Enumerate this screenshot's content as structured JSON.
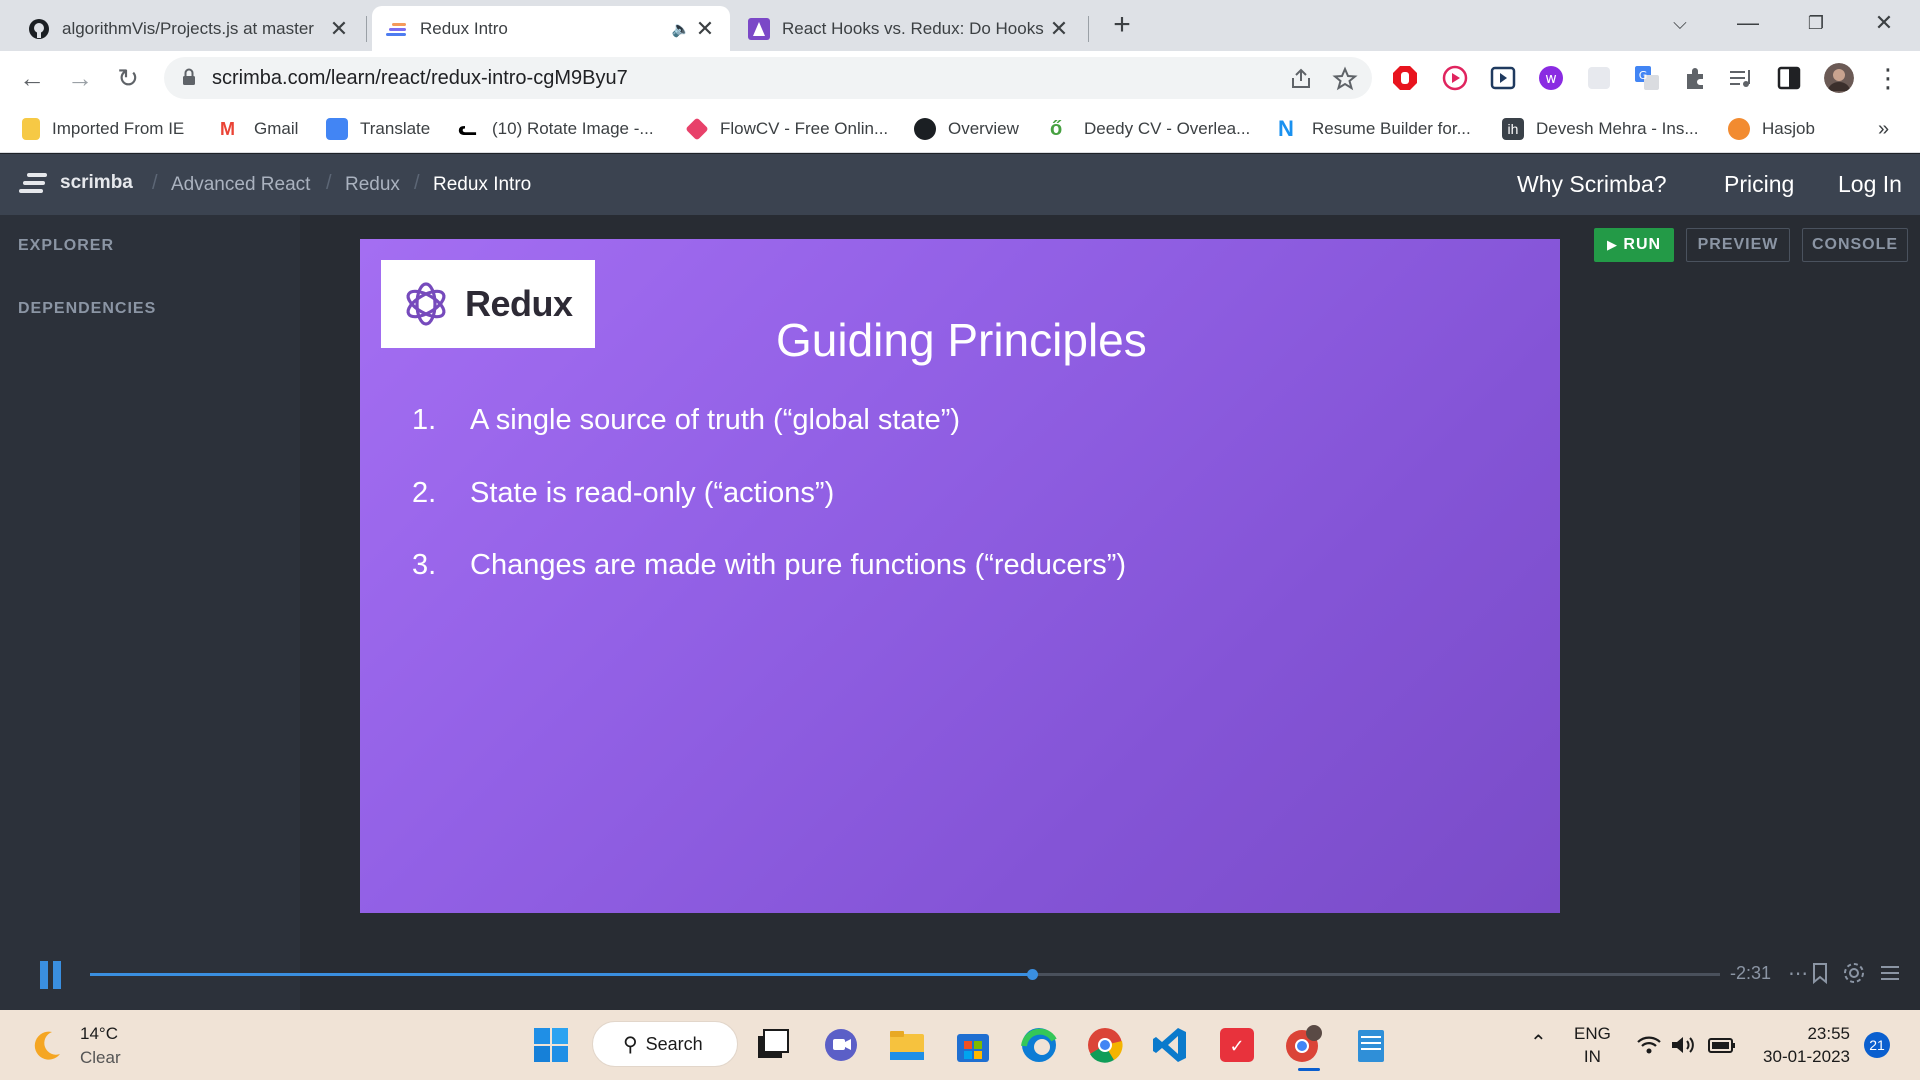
{
  "browser": {
    "tabs": [
      {
        "title": "algorithmVis/Projects.js at master"
      },
      {
        "title": "Redux Intro"
      },
      {
        "title": "React Hooks vs. Redux: Do Hooks"
      }
    ],
    "url": "scrimba.com/learn/react/redux-intro-cgM9Byu7",
    "bookmarks": [
      "Imported From IE",
      "Gmail",
      "Translate",
      "(10) Rotate Image -...",
      "FlowCV - Free Onlin...",
      "Overview",
      "Deedy CV - Overlea...",
      "Resume Builder for...",
      "Devesh Mehra - Ins...",
      "Hasjob"
    ],
    "overflow_label": "»"
  },
  "scrimba": {
    "logo_text": "scrimba",
    "breadcrumbs": [
      "Advanced React",
      "Redux",
      "Redux Intro"
    ],
    "nav": {
      "why": "Why Scrimba?",
      "pricing": "Pricing",
      "login": "Log In"
    },
    "sidebar": {
      "explorer": "EXPLORER",
      "dependencies": "DEPENDENCIES"
    },
    "buttons": {
      "run": "RUN",
      "preview": "PREVIEW",
      "console": "CONSOLE"
    }
  },
  "slide": {
    "logo_word": "Redux",
    "title": "Guiding Principles",
    "principles": [
      {
        "num": "1.",
        "text": "A single source of truth (“global state”)"
      },
      {
        "num": "2.",
        "text": "State is read-only (“actions”)"
      },
      {
        "num": "3.",
        "text": "Changes are made with pure functions (“reducers”)"
      }
    ]
  },
  "player": {
    "time_remaining": "-2:31",
    "progress_fraction": 0.578
  },
  "taskbar": {
    "weather_temp": "14°C",
    "weather_cond": "Clear",
    "search_label": "Search",
    "lang_1": "ENG",
    "lang_2": "IN",
    "time": "23:55",
    "date": "30-01-2023",
    "notifications": "21"
  },
  "colors": {
    "accent": "#3a8fe0",
    "run_green": "#239a47",
    "slide_purple": "#9361e6"
  }
}
